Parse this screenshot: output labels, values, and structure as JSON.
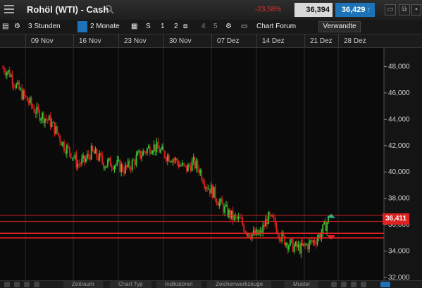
{
  "header": {
    "title": "Rohöl (WTI) - Cash",
    "change": "-23,58%",
    "bid": "36,394",
    "ask": "36,429",
    "bid_arrow": "↑",
    "ask_arrow": "↑"
  },
  "toolbar": {
    "range_label": "3 Stunden",
    "period_label": "2 Monate",
    "s_label": "S",
    "n1": "1",
    "n2": "2",
    "n4": "4",
    "n5": "5",
    "chart_forum": "Chart Forum",
    "verwandte": "Verwandte"
  },
  "dates": [
    "09 Nov",
    "16 Nov",
    "23 Nov",
    "30 Nov",
    "07 Dez",
    "14 Dez",
    "21 Dez",
    "28 Dez"
  ],
  "bottom_tabs": [
    "Zeitraum",
    "Chart Typ",
    "Indikatoren",
    "Zeichenwerkzeuge",
    "Muster"
  ],
  "current_price": "36,411",
  "colors": {
    "up": "#33cc33",
    "down": "#e02020",
    "accent": "#1e73b8",
    "line": "#e02020"
  },
  "chart_data": {
    "type": "candlestick",
    "y_ticks": [
      "32,000",
      "34,000",
      "36,000",
      "38,000",
      "40,000",
      "42,000",
      "44,000",
      "46,000",
      "48,000"
    ],
    "ylim": [
      32,
      49.2
    ],
    "x_labels": [
      "09 Nov",
      "16 Nov",
      "23 Nov",
      "30 Nov",
      "07 Dez",
      "14 Dez",
      "21 Dez",
      "28 Dez"
    ],
    "trend_path": [
      47.9,
      47.5,
      46.5,
      45.8,
      45.2,
      44.5,
      44.2,
      43.8,
      43.0,
      42.0,
      41.5,
      40.6,
      40.8,
      41.5,
      41.2,
      40.6,
      40.7,
      40.5,
      40.2,
      40.6,
      41.2,
      41.6,
      42.0,
      41.7,
      41.3,
      41.1,
      40.6,
      40.2,
      40.7,
      40.2,
      39.0,
      38.5,
      37.6,
      37.0,
      36.5,
      36.3,
      35.5,
      35.2,
      35.3,
      36.5,
      36.2,
      35.1,
      34.6,
      34.3,
      34.2,
      34.5,
      34.8,
      35.4,
      36.4
    ],
    "horizontal_lines": [
      36.4,
      35.0,
      35.4
    ]
  }
}
